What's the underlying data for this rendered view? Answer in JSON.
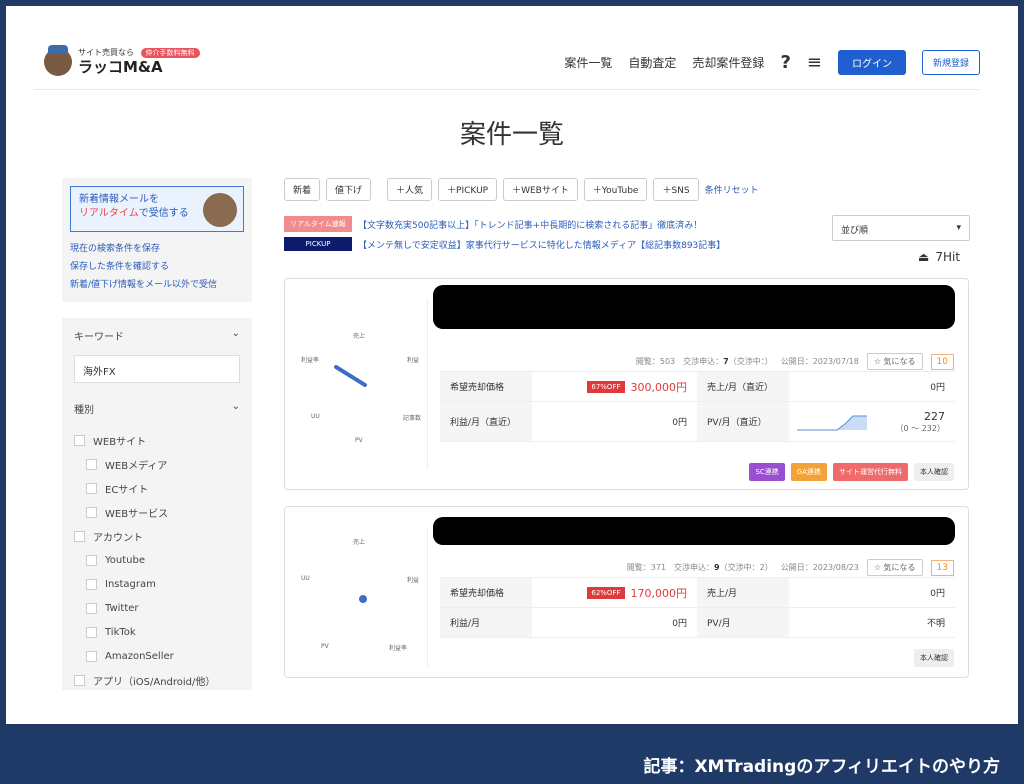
{
  "header": {
    "logo_tagline": "サイト売買なら",
    "logo_badge": "仲介手数料無料",
    "logo_name": "ラッコM&A",
    "nav": [
      "案件一覧",
      "自動査定",
      "売却案件登録"
    ],
    "help_icon": "?",
    "menu_icon": "≡",
    "login": "ログイン",
    "register": "新規登録"
  },
  "page_title": "案件一覧",
  "sidebar": {
    "mail_box_line1": "新着情報メールを",
    "mail_box_red": "リアルタイム",
    "mail_box_line2": "で受信する",
    "links": [
      "現在の検索条件を保存",
      "保存した条件を確認する",
      "新着/値下げ情報をメール以外で受信"
    ],
    "keyword_label": "キーワード",
    "keyword_value": "海外FX",
    "category_label": "種別",
    "categories": [
      {
        "label": "WEBサイト",
        "sub": false
      },
      {
        "label": "WEBメディア",
        "sub": true
      },
      {
        "label": "ECサイト",
        "sub": true
      },
      {
        "label": "WEBサービス",
        "sub": true
      },
      {
        "label": "アカウント",
        "sub": false
      },
      {
        "label": "Youtube",
        "sub": true
      },
      {
        "label": "Instagram",
        "sub": true
      },
      {
        "label": "Twitter",
        "sub": true
      },
      {
        "label": "TikTok",
        "sub": true
      },
      {
        "label": "AmazonSeller",
        "sub": true
      },
      {
        "label": "アプリ（iOS/Android/他）",
        "sub": false
      }
    ]
  },
  "filters": {
    "chips": [
      "新着",
      "値下げ",
      "＋人気",
      "＋PICKUP",
      "＋WEBサイト",
      "＋YouTube",
      "＋SNS"
    ],
    "reset": "条件リセット"
  },
  "notices": [
    {
      "tag": "リアルタイム速報",
      "text": "【文字数充実500記事以上】「トレンド記事+中長期的に検索される記事」徹底済み！"
    },
    {
      "tag": "PICKUP",
      "text": "【メンテ無しで安定収益】家事代行サービスに特化した情報メディア【総記事数893記事】"
    }
  ],
  "sort_label": "並び順",
  "hit_count": "7Hit",
  "cards": [
    {
      "views": "閲覧：503",
      "nego_label": "交渉申込：",
      "nego_count": "7",
      "nego_note": "（交渉中：）",
      "published": "公開日：2023/07/18",
      "fav": "気になる",
      "fav_count": "10",
      "radar_labels": [
        "売上",
        "利益",
        "利益率",
        "PV",
        "UU",
        "記事数"
      ],
      "rows": [
        {
          "label": "希望売却価格",
          "off": "67%OFF",
          "price": "300,000円",
          "label2": "売上/月（直近）",
          "val2": "0円"
        },
        {
          "label": "利益/月（直近）",
          "val1": "0円",
          "label2": "PV/月（直近）",
          "val2": "227",
          "val2_sub": "（0 〜 232）"
        }
      ],
      "badges": [
        "SC連携",
        "GA連携",
        "サイト運営代行無料",
        "本人確認"
      ]
    },
    {
      "views": "閲覧：371",
      "nego_label": "交渉申込：",
      "nego_count": "9",
      "nego_note": "（交渉中：2）",
      "published": "公開日：2023/08/23",
      "fav": "気になる",
      "fav_count": "13",
      "radar_labels": [
        "売上",
        "利益",
        "UU",
        "PV",
        "利益率"
      ],
      "rows": [
        {
          "label": "希望売却価格",
          "off": "62%OFF",
          "price": "170,000円",
          "label2": "売上/月",
          "val2": "0円"
        },
        {
          "label": "利益/月",
          "val1": "0円",
          "label2": "PV/月",
          "val2": "不明"
        }
      ],
      "badges": [
        "本人確認"
      ]
    }
  ],
  "caption": "記事：XMTradingのアフィリエイトのやり方",
  "colors": {
    "frame": "#1f3a67",
    "accent": "#1f5fcf",
    "red": "#e03b3b"
  }
}
